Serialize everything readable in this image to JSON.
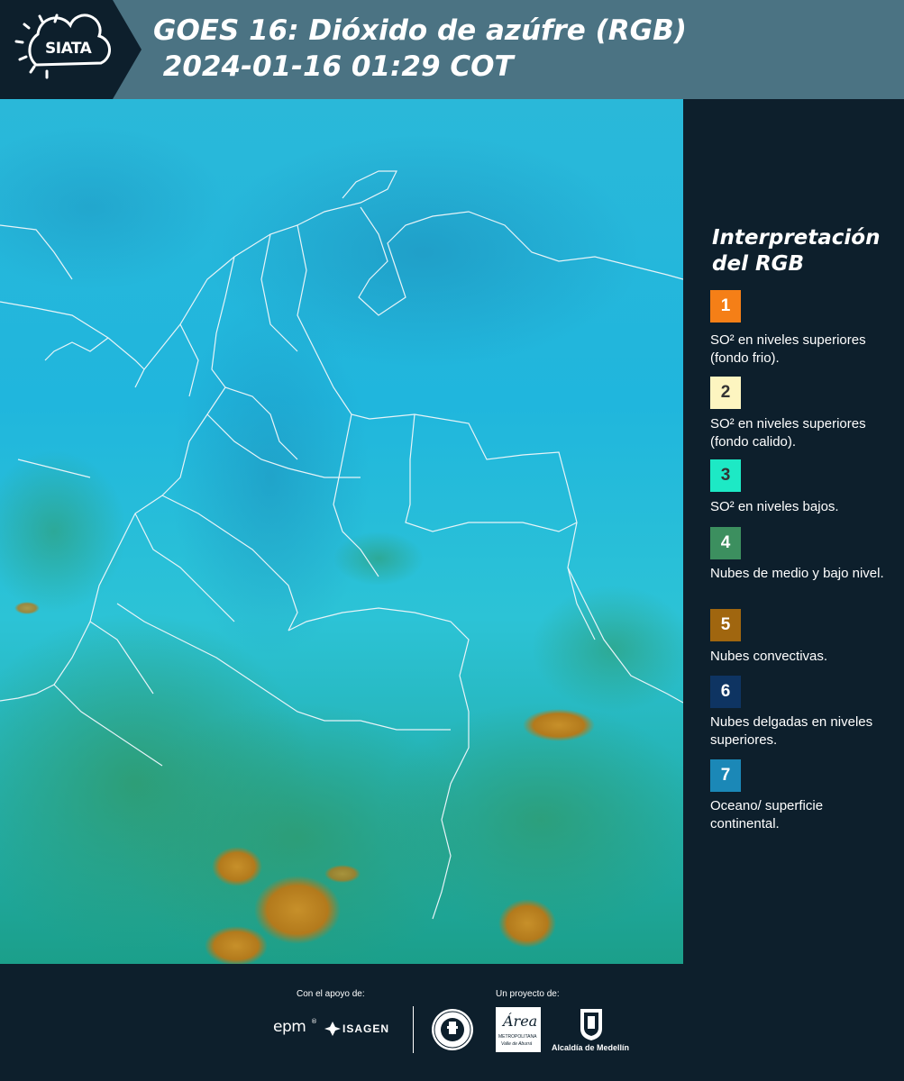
{
  "header": {
    "logo_text": "SIATA",
    "title": "GOES 16: Dióxido de azúfre (RGB)\n 2024-01-16 01:29 COT"
  },
  "legend": {
    "title": "Interpretación del RGB",
    "items": [
      {
        "num": "1",
        "color": "#f57f17",
        "num_color": "#ffffff",
        "text": "SO² en niveles superiores (fondo frio)."
      },
      {
        "num": "2",
        "color": "#fdf5c0",
        "num_color": "#333333",
        "text": "SO² en niveles superiores (fondo calido)."
      },
      {
        "num": "3",
        "color": "#1de9c5",
        "num_color": "#333333",
        "text": "SO² en niveles bajos."
      },
      {
        "num": "4",
        "color": "#3c8f5f",
        "num_color": "#ffffff",
        "text": "Nubes de medio y bajo nivel."
      },
      {
        "num": "5",
        "color": "#a0660f",
        "num_color": "#ffffff",
        "text": "Nubes convectivas."
      },
      {
        "num": "6",
        "color": "#0e3462",
        "num_color": "#ffffff",
        "text": "Nubes delgadas en niveles superiores."
      },
      {
        "num": "7",
        "color": "#1b88b7",
        "num_color": "#ffffff",
        "text": "Oceano/ superficie continental."
      }
    ]
  },
  "footer": {
    "support_label": "Con el apoyo de:",
    "project_label": "Un proyecto de:",
    "logo_epm": "epm",
    "logo_isagen": "ISAGEN",
    "logo_area": "Área",
    "logo_area_sub": "METROPOLITANA",
    "logo_area_sub2": "Valle de Aburrá",
    "logo_alcaldia": "Alcaldía de Medellín"
  }
}
